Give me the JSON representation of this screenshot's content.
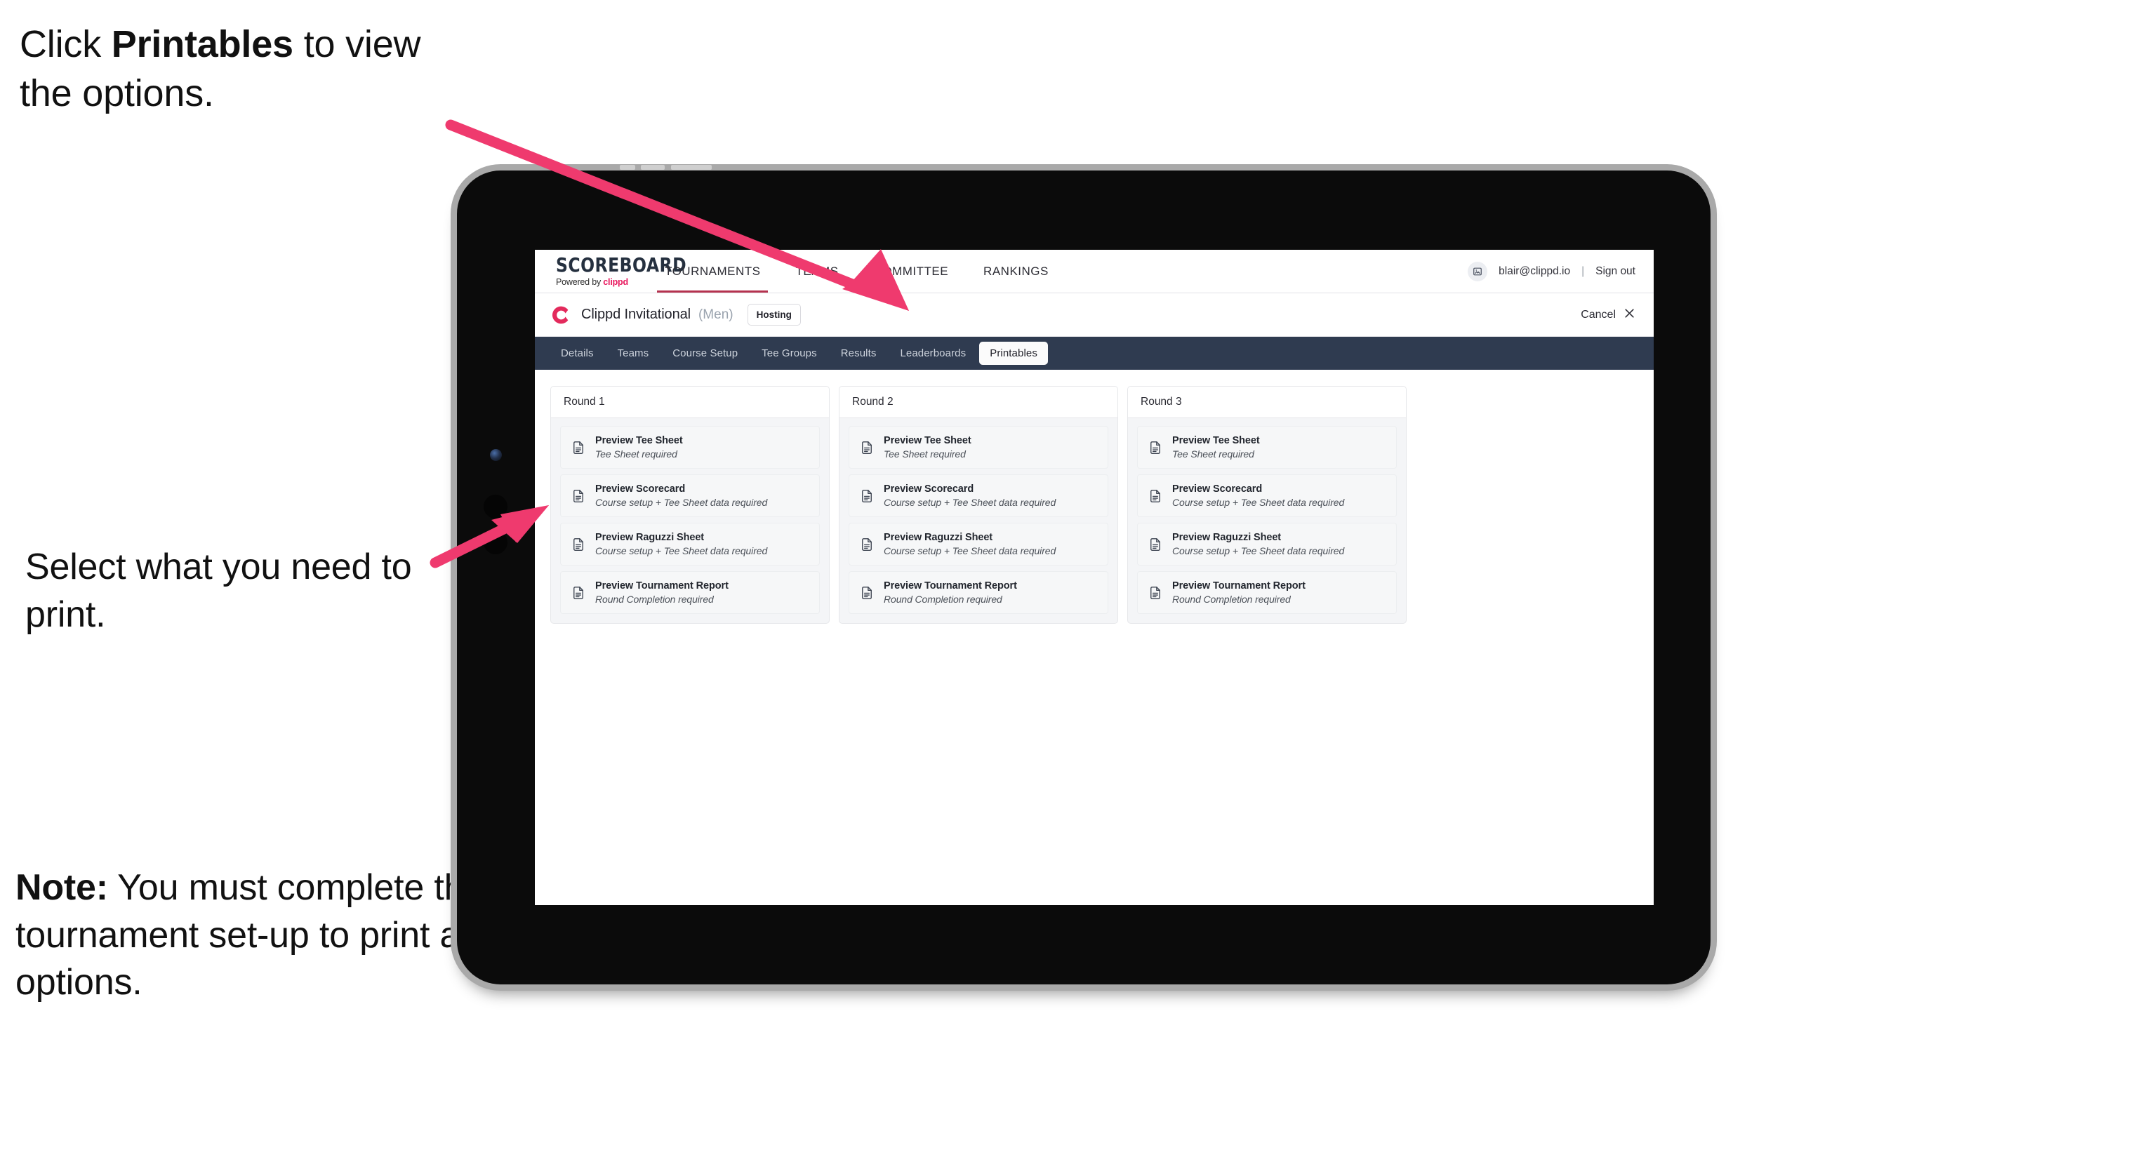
{
  "annotations": [
    {
      "id": "anno-1",
      "pre": "Click ",
      "strong": "Printables",
      "post": " to view the options."
    },
    {
      "id": "anno-2",
      "pre": "Select what you need to print.",
      "strong": "",
      "post": ""
    },
    {
      "id": "anno-3",
      "pre": "",
      "strong": "Note:",
      "post": " You must complete the tournament set-up to print all the options."
    }
  ],
  "colors": {
    "accent_pink": "#ef3a6e",
    "brand_pink": "#e8175d",
    "navy_tabbar": "#2f3b50",
    "logo_navy": "#25303f",
    "tablet_body": "#0b0b0b",
    "tablet_bezel": "#a9a9a9",
    "card_bg": "#f4f5f7"
  },
  "topbar": {
    "logo_main": "SCOREBOARD",
    "logo_sub_prefix": "Powered by ",
    "logo_sub_brand": "clippd",
    "nav": [
      {
        "label": "TOURNAMENTS",
        "active": true
      },
      {
        "label": "TEAMS",
        "active": false
      },
      {
        "label": "COMMITTEE",
        "active": false
      },
      {
        "label": "RANKINGS",
        "active": false
      }
    ],
    "account_email": "blair@clippd.io",
    "separator": "|",
    "sign_out": "Sign out",
    "avatar_icon": "user-avatar-icon"
  },
  "tournament_bar": {
    "logo_icon": "clippd-c-icon",
    "name": "Clippd Invitational",
    "gender": "(Men)",
    "badge": "Hosting",
    "cancel_label": "Cancel",
    "cancel_icon": "close-x-icon"
  },
  "tabs": [
    {
      "label": "Details",
      "active": false
    },
    {
      "label": "Teams",
      "active": false
    },
    {
      "label": "Course Setup",
      "active": false
    },
    {
      "label": "Tee Groups",
      "active": false
    },
    {
      "label": "Results",
      "active": false
    },
    {
      "label": "Leaderboards",
      "active": false
    },
    {
      "label": "Printables",
      "active": true
    }
  ],
  "rounds": [
    {
      "title": "Round 1",
      "items": [
        {
          "title": "Preview Tee Sheet",
          "sub": "Tee Sheet required",
          "icon": "document-icon"
        },
        {
          "title": "Preview Scorecard",
          "sub": "Course setup + Tee Sheet data required",
          "icon": "document-icon"
        },
        {
          "title": "Preview Raguzzi Sheet",
          "sub": "Course setup + Tee Sheet data required",
          "icon": "document-icon"
        },
        {
          "title": "Preview Tournament Report",
          "sub": "Round Completion required",
          "icon": "document-icon"
        }
      ]
    },
    {
      "title": "Round 2",
      "items": [
        {
          "title": "Preview Tee Sheet",
          "sub": "Tee Sheet required",
          "icon": "document-icon"
        },
        {
          "title": "Preview Scorecard",
          "sub": "Course setup + Tee Sheet data required",
          "icon": "document-icon"
        },
        {
          "title": "Preview Raguzzi Sheet",
          "sub": "Course setup + Tee Sheet data required",
          "icon": "document-icon"
        },
        {
          "title": "Preview Tournament Report",
          "sub": "Round Completion required",
          "icon": "document-icon"
        }
      ]
    },
    {
      "title": "Round 3",
      "items": [
        {
          "title": "Preview Tee Sheet",
          "sub": "Tee Sheet required",
          "icon": "document-icon"
        },
        {
          "title": "Preview Scorecard",
          "sub": "Course setup + Tee Sheet data required",
          "icon": "document-icon"
        },
        {
          "title": "Preview Raguzzi Sheet",
          "sub": "Course setup + Tee Sheet data required",
          "icon": "document-icon"
        },
        {
          "title": "Preview Tournament Report",
          "sub": "Round Completion required",
          "icon": "document-icon"
        }
      ]
    }
  ]
}
